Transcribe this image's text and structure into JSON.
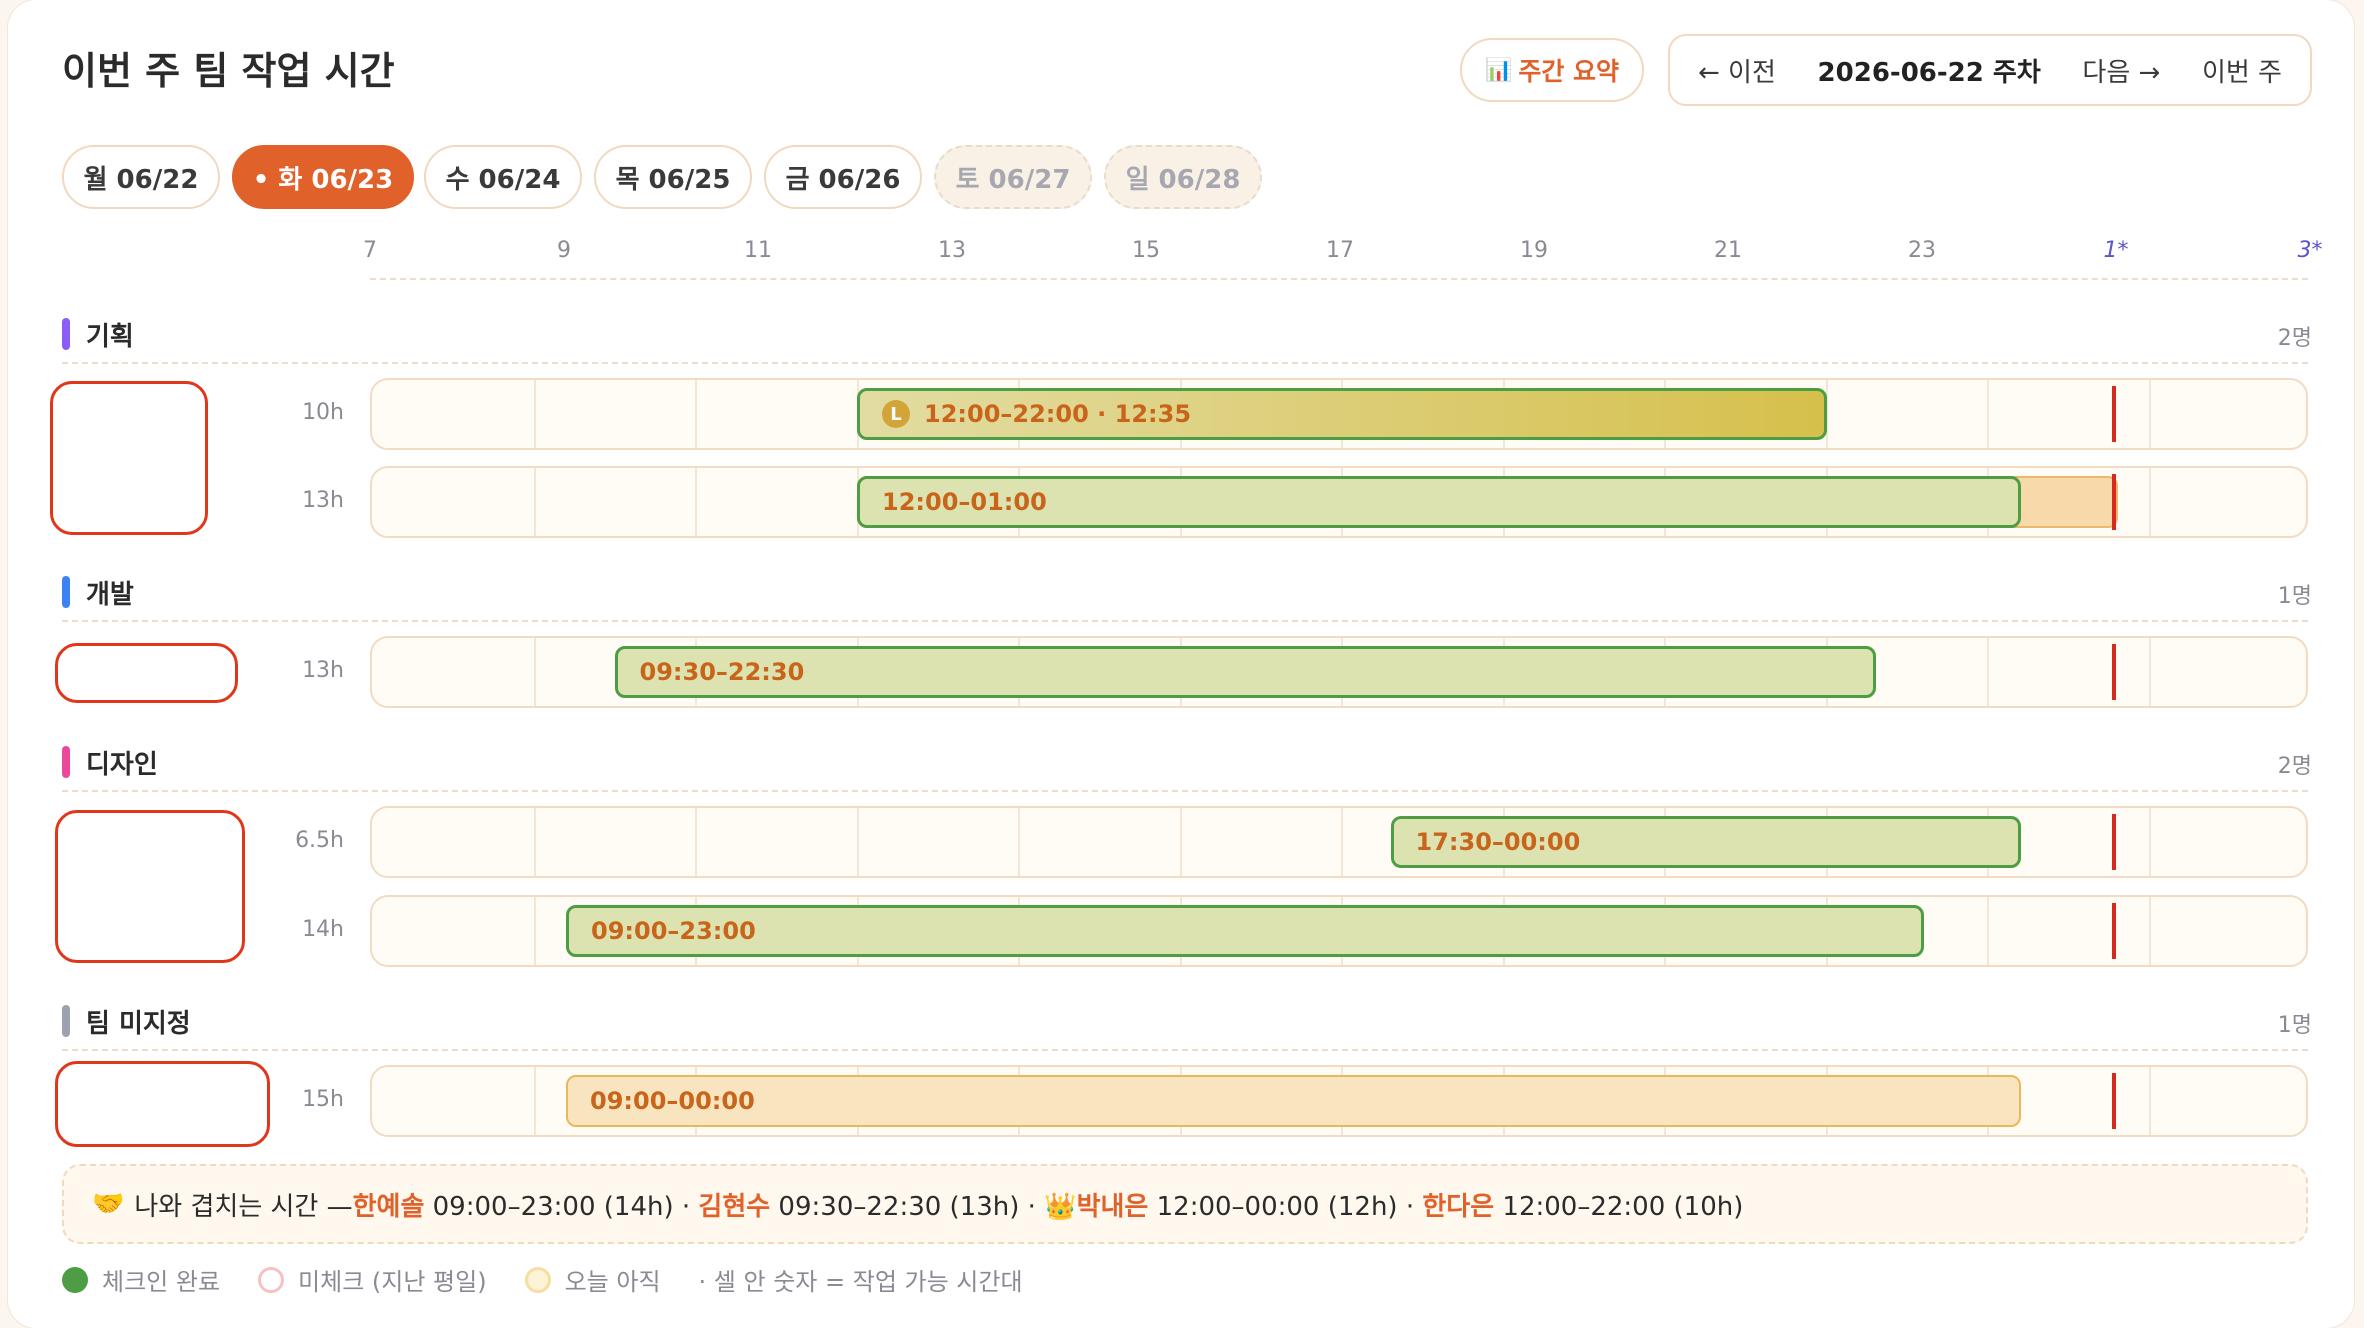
{
  "header": {
    "title": "이번 주 팀 작업 시간",
    "summary_icon": "📊",
    "summary_label": "주간 요약",
    "prev_label": "← 이전",
    "week_label": "2026-06-22 주차",
    "next_label": "다음 →",
    "this_week_label": "이번 주"
  },
  "days": [
    {
      "label": "월 06/22",
      "state": "normal"
    },
    {
      "label": "• 화 06/23",
      "state": "active"
    },
    {
      "label": "수 06/24",
      "state": "normal"
    },
    {
      "label": "목 06/25",
      "state": "normal"
    },
    {
      "label": "금 06/26",
      "state": "normal"
    },
    {
      "label": "토 06/27",
      "state": "weekend"
    },
    {
      "label": "일 06/28",
      "state": "weekend"
    }
  ],
  "axis": {
    "ticks": [
      "7",
      "9",
      "11",
      "13",
      "15",
      "17",
      "19",
      "21",
      "23",
      "1*",
      "3*"
    ]
  },
  "teams": [
    {
      "name": "기획",
      "color": "#8b5cf6",
      "count": "2명",
      "members": [
        {
          "hours": "10h",
          "bar": {
            "label": "12:00–22:00 · 12:35",
            "style": "gold",
            "start": 12,
            "end": 22,
            "lead_badge": "L"
          }
        },
        {
          "hours": "13h",
          "bar": {
            "label": "12:00–01:00",
            "style": "green",
            "start": 12,
            "end": 24,
            "tail_end": 25
          }
        }
      ]
    },
    {
      "name": "개발",
      "color": "#3b82f6",
      "count": "1명",
      "members": [
        {
          "hours": "13h",
          "bar": {
            "label": "09:30–22:30",
            "style": "green",
            "start": 9.5,
            "end": 22.5
          }
        }
      ]
    },
    {
      "name": "디자인",
      "color": "#ec4899",
      "count": "2명",
      "members": [
        {
          "hours": "6.5h",
          "bar": {
            "label": "17:30–00:00",
            "style": "green",
            "start": 17.5,
            "end": 24
          }
        },
        {
          "hours": "14h",
          "bar": {
            "label": "09:00–23:00",
            "style": "green",
            "start": 9,
            "end": 23
          }
        }
      ]
    },
    {
      "name": "팀 미지정",
      "color": "#9ca3af",
      "count": "1명",
      "members": [
        {
          "hours": "15h",
          "bar": {
            "label": "09:00–00:00",
            "style": "amber",
            "start": 9,
            "end": 24
          }
        }
      ]
    }
  ],
  "now_hour": 25,
  "overlap": {
    "icon": "🤝",
    "prefix": "나와 겹치는 시간 — ",
    "entries": [
      {
        "crown": "",
        "name": "한예솔",
        "time": " 09:00–23:00 (14h)"
      },
      {
        "crown": "",
        "name": "김현수",
        "time": " 09:30–22:30 (13h)"
      },
      {
        "crown": "👑",
        "name": "박내은",
        "time": " 12:00–00:00 (12h)"
      },
      {
        "crown": "",
        "name": "한다은",
        "time": " 12:00–22:00 (10h)"
      }
    ],
    "separator": " · "
  },
  "legend": {
    "items": [
      {
        "label": "체크인 완료",
        "color": "#4c9d43"
      },
      {
        "label": "미체크 (지난 평일)",
        "color": "#f4c2c2"
      },
      {
        "label": "오늘 아직",
        "color": "#f7dea0"
      }
    ],
    "note": "· 셀 안 숫자 = 작업 가능 시간대"
  }
}
